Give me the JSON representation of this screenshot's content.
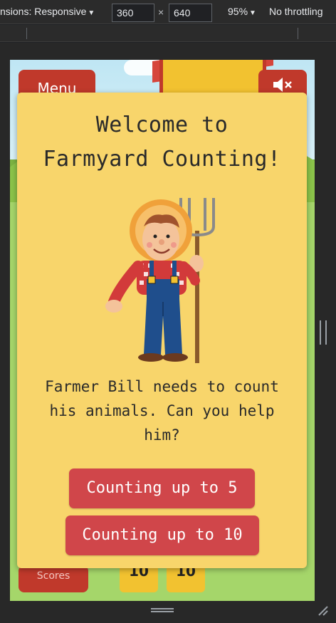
{
  "devtools": {
    "dimensions_label": "nsions: Responsive",
    "width_value": "360",
    "height_value": "640",
    "times": "×",
    "zoom_label": "95%",
    "throttle_label": "No throttling"
  },
  "game": {
    "menu_label": "Menu",
    "scores_label": "Scores",
    "tiles": [
      "10",
      "10"
    ]
  },
  "modal": {
    "title_line1": "Welcome to",
    "title_line2": "Farmyard Counting!",
    "description": "Farmer Bill needs to count his animals. Can you help him?",
    "buttons": [
      "Counting up to 5",
      "Counting up to 10"
    ]
  },
  "colors": {
    "modal_bg": "#f8d56b",
    "button_red": "#d0464a",
    "menu_red": "#c0392b"
  }
}
